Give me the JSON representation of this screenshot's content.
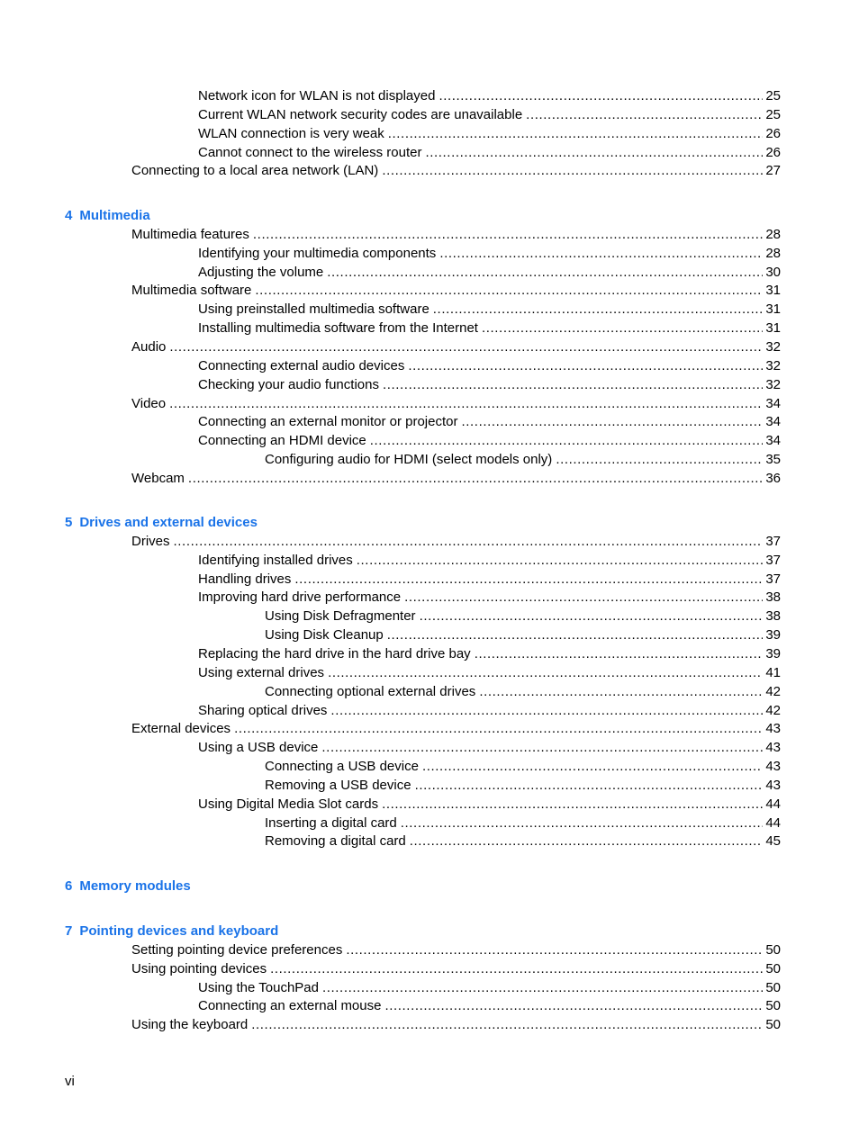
{
  "accent_color": "#1a73e8",
  "entries_top": [
    {
      "level": 2,
      "title": "Network icon for WLAN is not displayed",
      "page": "25"
    },
    {
      "level": 2,
      "title": "Current WLAN network security codes are unavailable",
      "page": "25"
    },
    {
      "level": 2,
      "title": "WLAN connection is very weak",
      "page": "26"
    },
    {
      "level": 2,
      "title": "Cannot connect to the wireless router",
      "page": "26"
    },
    {
      "level": 1,
      "title": "Connecting to a local area network (LAN)",
      "page": "27"
    }
  ],
  "chapters": [
    {
      "number": "4",
      "title": "Multimedia",
      "entries": [
        {
          "level": 1,
          "title": "Multimedia features",
          "page": "28"
        },
        {
          "level": 2,
          "title": "Identifying your multimedia components",
          "page": "28"
        },
        {
          "level": 2,
          "title": "Adjusting the volume",
          "page": "30"
        },
        {
          "level": 1,
          "title": "Multimedia software",
          "page": "31"
        },
        {
          "level": 2,
          "title": "Using preinstalled multimedia software",
          "page": "31"
        },
        {
          "level": 2,
          "title": "Installing multimedia software from the Internet",
          "page": "31"
        },
        {
          "level": 1,
          "title": "Audio",
          "page": "32"
        },
        {
          "level": 2,
          "title": "Connecting external audio devices",
          "page": "32"
        },
        {
          "level": 2,
          "title": "Checking your audio functions",
          "page": "32"
        },
        {
          "level": 1,
          "title": "Video",
          "page": "34"
        },
        {
          "level": 2,
          "title": "Connecting an external monitor or projector",
          "page": "34"
        },
        {
          "level": 2,
          "title": "Connecting an HDMI device",
          "page": "34"
        },
        {
          "level": 3,
          "title": "Configuring audio for HDMI (select models only)",
          "page": "35"
        },
        {
          "level": 1,
          "title": "Webcam",
          "page": "36"
        }
      ]
    },
    {
      "number": "5",
      "title": "Drives and external devices",
      "entries": [
        {
          "level": 1,
          "title": "Drives",
          "page": "37"
        },
        {
          "level": 2,
          "title": "Identifying installed drives",
          "page": "37"
        },
        {
          "level": 2,
          "title": "Handling drives",
          "page": "37"
        },
        {
          "level": 2,
          "title": "Improving hard drive performance",
          "page": "38"
        },
        {
          "level": 3,
          "title": "Using Disk Defragmenter",
          "page": "38"
        },
        {
          "level": 3,
          "title": "Using Disk Cleanup",
          "page": "39"
        },
        {
          "level": 2,
          "title": "Replacing the hard drive in the hard drive bay",
          "page": "39"
        },
        {
          "level": 2,
          "title": "Using external drives",
          "page": "41"
        },
        {
          "level": 3,
          "title": "Connecting optional external drives",
          "page": "42"
        },
        {
          "level": 2,
          "title": "Sharing optical drives",
          "page": "42"
        },
        {
          "level": 1,
          "title": "External devices",
          "page": "43"
        },
        {
          "level": 2,
          "title": "Using a USB device",
          "page": "43"
        },
        {
          "level": 3,
          "title": "Connecting a USB device",
          "page": "43"
        },
        {
          "level": 3,
          "title": "Removing a USB device",
          "page": "43"
        },
        {
          "level": 2,
          "title": "Using Digital Media Slot cards",
          "page": "44"
        },
        {
          "level": 3,
          "title": "Inserting a digital card",
          "page": "44"
        },
        {
          "level": 3,
          "title": "Removing a digital card",
          "page": "45"
        }
      ]
    },
    {
      "number": "6",
      "title": "Memory modules",
      "entries": []
    },
    {
      "number": "7",
      "title": "Pointing devices and keyboard",
      "entries": [
        {
          "level": 1,
          "title": "Setting pointing device preferences",
          "page": "50"
        },
        {
          "level": 1,
          "title": "Using pointing devices",
          "page": "50"
        },
        {
          "level": 2,
          "title": "Using the TouchPad",
          "page": "50"
        },
        {
          "level": 2,
          "title": "Connecting an external mouse",
          "page": "50"
        },
        {
          "level": 1,
          "title": "Using the keyboard",
          "page": "50"
        }
      ]
    }
  ],
  "footer": {
    "page_number": "vi"
  }
}
